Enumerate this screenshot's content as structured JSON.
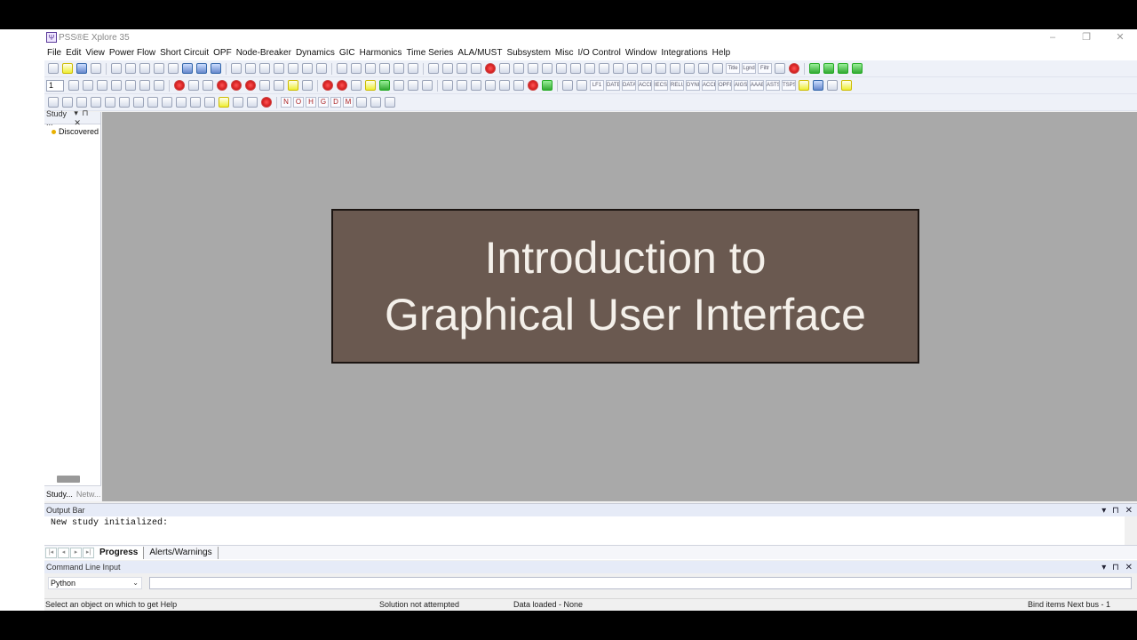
{
  "window": {
    "title": "PSS®E Xplore 35",
    "controls": [
      "–",
      "❐",
      "✕"
    ]
  },
  "menu": [
    "File",
    "Edit",
    "View",
    "Power Flow",
    "Short Circuit",
    "OPF",
    "Node-Breaker",
    "Dynamics",
    "GIC",
    "Harmonics",
    "Time Series",
    "ALA/MUST",
    "Subsystem",
    "Misc",
    "I/O Control",
    "Window",
    "Integrations",
    "Help"
  ],
  "toolbar2": {
    "zoom_combo": "1",
    "text_buttons": [
      "LF1",
      "DATE",
      "DATA",
      "ACCE",
      "IECS",
      "RELU",
      "DYNI",
      "ACCE",
      "OPF8",
      "AIGS",
      "AAAB",
      "ASTS",
      "TSPS"
    ]
  },
  "toolbar3": {
    "letter_buttons": [
      "N",
      "O",
      "H",
      "G",
      "D",
      "M"
    ]
  },
  "left_panel": {
    "title": "Study ...",
    "controls": "▾ ⊓ ✕",
    "tree_items": [
      "Discovered"
    ],
    "tabs": [
      "Study...",
      "Netw..."
    ]
  },
  "banner": {
    "line1": "Introduction to",
    "line2": "Graphical User Interface"
  },
  "output_bar": {
    "title": "Output Bar",
    "controls": "▾ ⊓ ✕",
    "text": "New study initialized:",
    "tabs": [
      "Progress",
      "Alerts/Warnings"
    ]
  },
  "command_line": {
    "title": "Command Line Input",
    "controls": "▾ ⊓ ✕",
    "language": "Python",
    "input_value": ""
  },
  "status": {
    "help": "Select an object on which to get Help",
    "solution": "Solution not attempted",
    "data": "Data loaded - None",
    "bind": "Bind items Next bus - 1"
  }
}
